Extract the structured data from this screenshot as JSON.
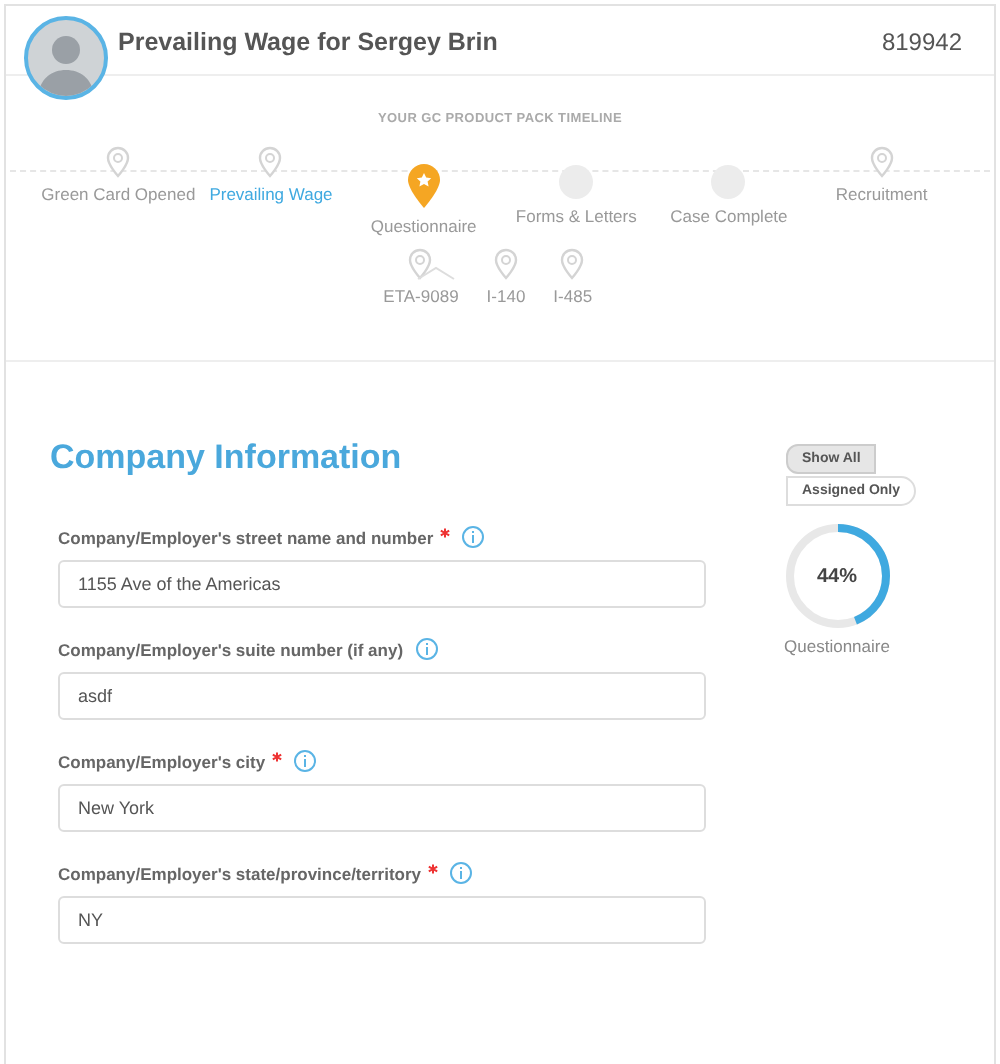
{
  "header": {
    "title": "Prevailing Wage for Sergey Brin",
    "case_number": "819942"
  },
  "timeline": {
    "title": "YOUR GC PRODUCT PACK TIMELINE",
    "milestones": [
      {
        "label": "Green Card Opened",
        "kind": "pin",
        "selected": false
      },
      {
        "label": "Prevailing Wage",
        "kind": "pin",
        "selected": true
      },
      {
        "label": "Questionnaire",
        "kind": "current",
        "selected": false,
        "children": [
          {
            "label": "ETA-9089",
            "kind": "pin",
            "selected": false
          },
          {
            "label": "I-140",
            "kind": "pin",
            "selected": false
          },
          {
            "label": "I-485",
            "kind": "pin",
            "selected": false
          }
        ]
      },
      {
        "label": "Forms & Letters",
        "kind": "circle",
        "selected": false
      },
      {
        "label": "Case Complete",
        "kind": "circle",
        "selected": false
      },
      {
        "label": "Recruitment",
        "kind": "pin",
        "selected": false
      }
    ]
  },
  "section": {
    "title": "Company Information",
    "filters": [
      {
        "label": "Show All",
        "selected": true
      },
      {
        "label": "Assigned Only",
        "selected": false
      }
    ],
    "progress": {
      "level": 0.44,
      "reading": "44%",
      "label": "Questionnaire"
    },
    "fields": [
      {
        "label": "Company/Employer's street name and number",
        "required": true,
        "value": "1155 Ave of the Americas"
      },
      {
        "label": "Company/Employer's suite number (if any)",
        "required": false,
        "value": "asdf"
      },
      {
        "label": "Company/Employer's city",
        "required": true,
        "value": "New York"
      },
      {
        "label": "Company/Employer's state/province/territory",
        "required": true,
        "value": "NY"
      }
    ]
  }
}
